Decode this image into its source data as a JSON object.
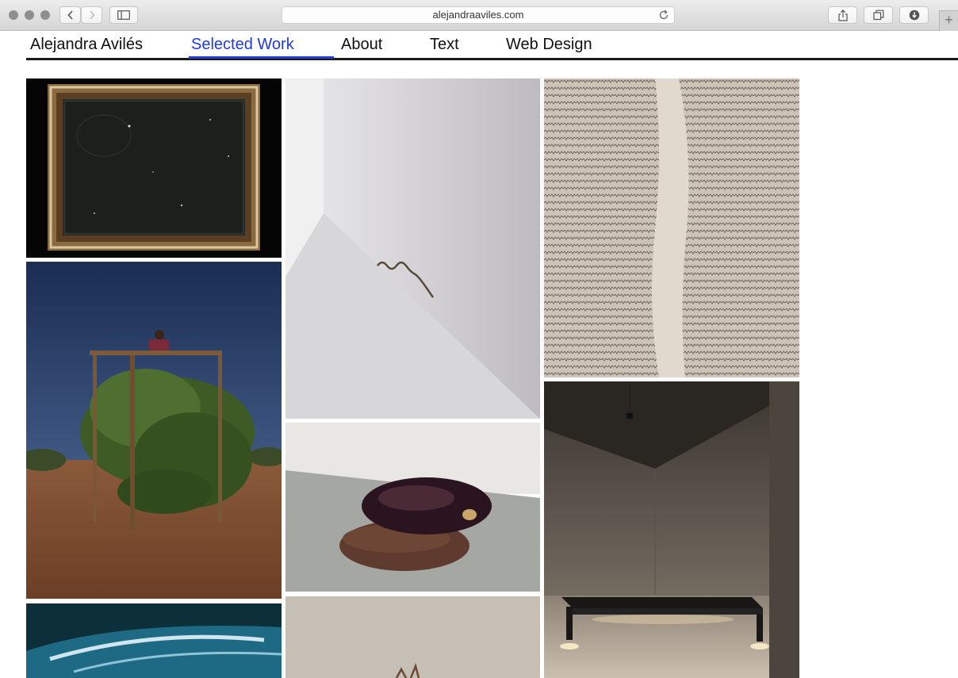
{
  "browser": {
    "url": "alejandraaviles.com",
    "new_tab_label": "+"
  },
  "site": {
    "name": "Alejandra Avilés",
    "nav": [
      "Selected Work",
      "About",
      "Text",
      "Web Design"
    ],
    "active_index": 0
  },
  "colors": {
    "accent": "#1f3bdc",
    "nav_text": "#111111",
    "rule": "#1a1a1a"
  },
  "gallery": [
    {
      "subject": "ornate-frame-dark-mirror"
    },
    {
      "subject": "figure-on-platform-above-tree"
    },
    {
      "subject": "underwater-blue"
    },
    {
      "subject": "snake-on-gallery-floor"
    },
    {
      "subject": "stacked-stones"
    },
    {
      "subject": "small-object-on-wall"
    },
    {
      "subject": "handwritten-wall-text"
    },
    {
      "subject": "lit-table-in-empty-room"
    }
  ]
}
